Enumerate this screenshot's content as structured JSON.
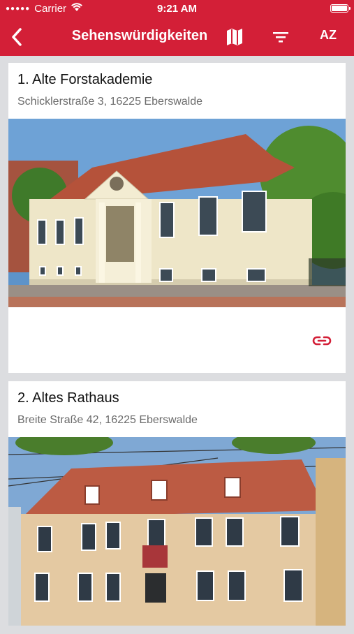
{
  "status": {
    "carrier": "Carrier",
    "time": "9:21 AM"
  },
  "nav": {
    "title": "Sehenswürdigkeiten",
    "sort_label": "AZ"
  },
  "colors": {
    "brand": "#d31f37",
    "background": "#dcdde0"
  },
  "icons": [
    "back-chevron-icon",
    "map-icon",
    "filter-icon",
    "sort-az-icon",
    "link-icon"
  ],
  "places": [
    {
      "title": "1. Alte Forstakademie",
      "address": "Schicklerstraße 3, 16225 Eberswalde"
    },
    {
      "title": "2. Altes Rathaus",
      "address": "Breite Straße 42, 16225 Eberswalde"
    }
  ]
}
